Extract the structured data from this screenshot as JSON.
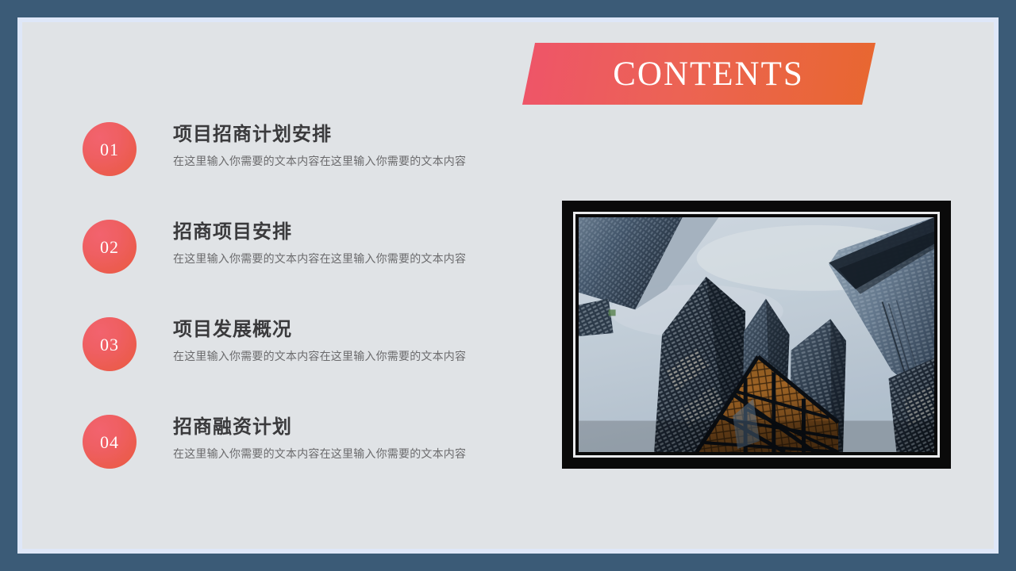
{
  "slide": {
    "banner": {
      "title": "CONTENTS"
    },
    "theme": {
      "border_color": "#3B5B77",
      "band_color": "#DEE7F8",
      "background_color": "#E0E3E6",
      "accent_start": "#EE5469",
      "accent_end": "#E8672F",
      "title_color": "#3A3A3C",
      "desc_color": "#6B6B6D",
      "frame_color": "#0A0A0A"
    },
    "agenda": [
      {
        "number": "01",
        "title": "项目招商计划安排",
        "desc": "在这里输入你需要的文本内容在这里输入你需要的文本内容"
      },
      {
        "number": "02",
        "title": "招商项目安排",
        "desc": "在这里输入你需要的文本内容在这里输入你需要的文本内容"
      },
      {
        "number": "03",
        "title": "项目发展概况",
        "desc": "在这里输入你需要的文本内容在这里输入你需要的文本内容"
      },
      {
        "number": "04",
        "title": "招商融资计划",
        "desc": "在这里输入你需要的文本内容在这里输入你需要的文本内容"
      }
    ],
    "photo": {
      "caption": "",
      "subject": "low-angle view of glass skyscrapers against a bright sky"
    }
  }
}
